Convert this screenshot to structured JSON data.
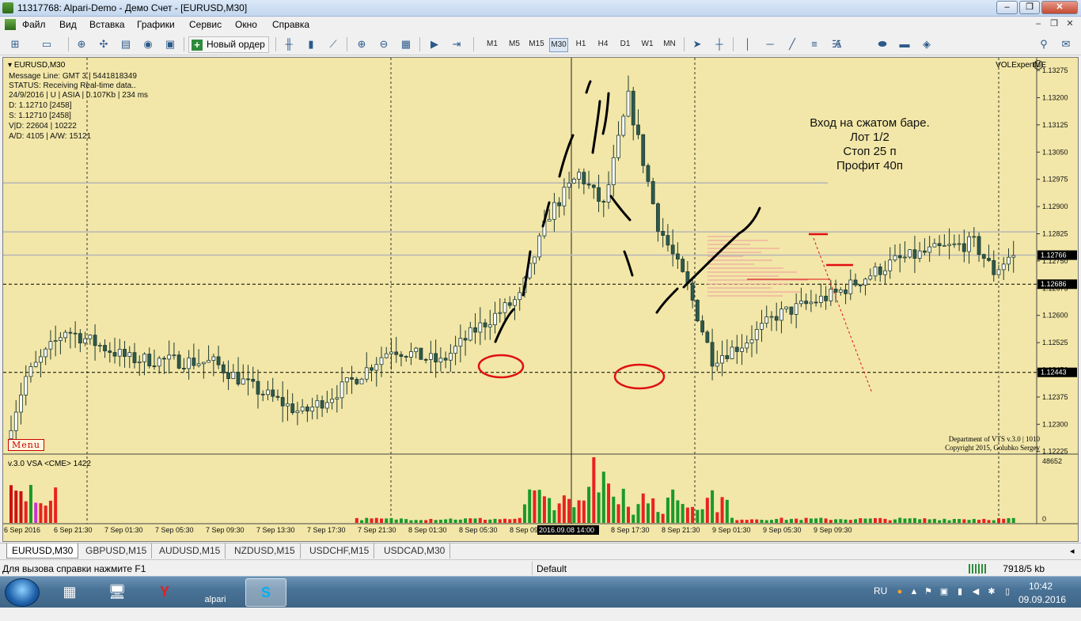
{
  "window": {
    "title": "11317768: Alpari-Demo - Демо Счет - [EURUSD,M30]",
    "minimize": "‒",
    "maximize": "❐",
    "close": "✕"
  },
  "menu": {
    "items": [
      "Файл",
      "Вид",
      "Вставка",
      "Графики",
      "Сервис",
      "Окно",
      "Справка"
    ]
  },
  "toolbar": {
    "new_order_label": "Новый ордер",
    "timeframes": [
      "M1",
      "M5",
      "M15",
      "M30",
      "H1",
      "H4",
      "D1",
      "W1",
      "MN"
    ],
    "active_timeframe": "M30"
  },
  "chart": {
    "symbol_line": "EURUSD,M30",
    "info_lines": [
      "Message Line: GMT 3 | 5441818349",
      "STATUS:  Receiving Real-time data..",
      "24/9/2016 | U | ASIA | 0.107Kb | 234 ms",
      "D: 1.12710  [2458]",
      "S: 1.12710  [2458]",
      "V|D: 22604 | 10222",
      "A/D: 4105 | A/W: 15121"
    ],
    "expert_label": "VOLExpertME",
    "expert_smile": "☺",
    "menu_tag": "Menu",
    "note_lines": [
      "Вход на сжатом баре.",
      "Лот 1/2",
      "Стоп 25 п",
      "Профит 40п"
    ],
    "copyright_lines": [
      "Department of VTS  v.3.0 | 1010",
      "Copyright 2015, Golubko Sergey"
    ],
    "price_labels": [
      "1.13275",
      "1.13200",
      "1.13125",
      "1.13050",
      "1.12975",
      "1.12900",
      "1.12825",
      "1.12750",
      "1.12675",
      "1.12600",
      "1.12525",
      "1.12450",
      "1.12375",
      "1.12300",
      "1.12225"
    ],
    "current_price": "1.12766",
    "level_high": "1.12686",
    "level_low": "1.12443",
    "vsa_label": "v.3.0 VSA <CME> 1422",
    "vsa_max": "48652",
    "vsa_zero": "0",
    "time_labels": [
      "6 Sep 2016",
      "6 Sep 21:30",
      "7 Sep 01:30",
      "7 Sep 05:30",
      "7 Sep 09:30",
      "7 Sep 13:30",
      "7 Sep 17:30",
      "7 Sep 21:30",
      "8 Sep 01:30",
      "8 Sep 05:30",
      "8 Sep 09:",
      "2016.09.08 14:00",
      "8 Sep 17:30",
      "8 Sep 21:30",
      "9 Sep 01:30",
      "9 Sep 05:30",
      "9 Sep 09:30"
    ],
    "colors": {
      "background": "#f2e7a8",
      "bull": "#ffffff",
      "bear": "#2f5a4c",
      "vol_up": "#1a9a2a",
      "vol_down": "#e8231f",
      "annotation_red": "#e01010"
    }
  },
  "tabs": [
    "EURUSD,M30",
    "GBPUSD,M15",
    "AUDUSD,M15",
    "NZDUSD,M15",
    "USDCHF,M15",
    "USDCAD,M30"
  ],
  "status": {
    "help": "Для вызова справки нажмите F1",
    "profile": "Default",
    "traffic": "7918/5 kb"
  },
  "taskbar": {
    "lang": "RU",
    "time": "10:42",
    "date": "09.09.2016",
    "apps": [
      "calc-app",
      "remote-app",
      "yandex-app",
      "alpari-app",
      "skype-app"
    ],
    "alpari_label": "alpari"
  }
}
